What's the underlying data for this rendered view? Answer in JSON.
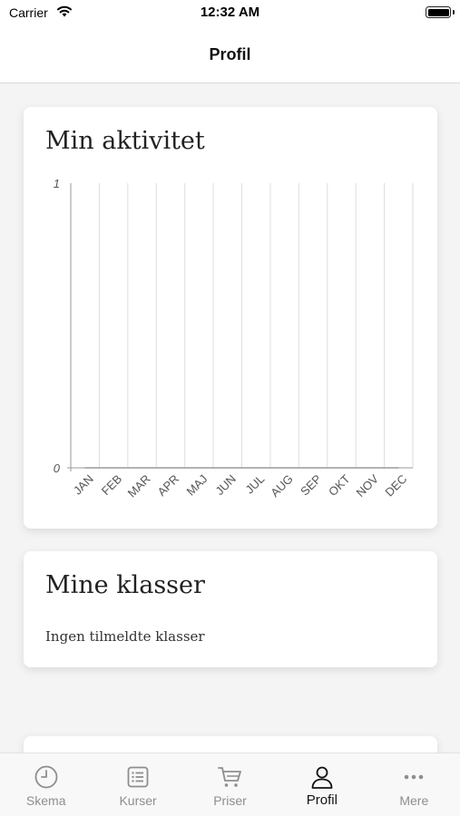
{
  "status_bar": {
    "carrier": "Carrier",
    "time": "12:32 AM"
  },
  "nav": {
    "title": "Profil"
  },
  "activity": {
    "title": "Min aktivitet",
    "chart_data": {
      "type": "line",
      "categories": [
        "JAN",
        "FEB",
        "MAR",
        "APR",
        "MAJ",
        "JUN",
        "JUL",
        "AUG",
        "SEP",
        "OKT",
        "NOV",
        "DEC"
      ],
      "series": [
        {
          "values": [
            0,
            0,
            0,
            0,
            0,
            0,
            0,
            0,
            0,
            0,
            0,
            0
          ]
        }
      ],
      "ylim": [
        0,
        1
      ],
      "yticks": [
        "0",
        "1"
      ],
      "grid": true
    }
  },
  "classes": {
    "title": "Mine klasser",
    "empty_text": "Ingen tilmeldte klasser"
  },
  "tabs": [
    {
      "label": "Skema",
      "icon": "clock-icon",
      "active": false
    },
    {
      "label": "Kurser",
      "icon": "list-icon",
      "active": false
    },
    {
      "label": "Priser",
      "icon": "cart-icon",
      "active": false
    },
    {
      "label": "Profil",
      "icon": "person-icon",
      "active": true
    },
    {
      "label": "Mere",
      "icon": "more-icon",
      "active": false
    }
  ]
}
